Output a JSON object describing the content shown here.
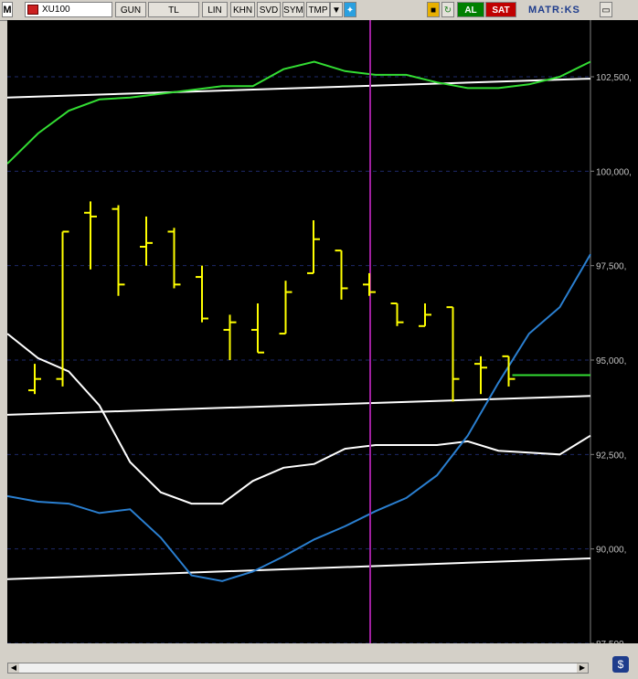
{
  "toolbar": {
    "m_label": "M",
    "symbol": "XU100",
    "buttons": [
      "GUN",
      "TL",
      "LIN",
      "KHN",
      "SVD",
      "SYM",
      "TMP"
    ],
    "buy_label": "AL",
    "sell_label": "SAT",
    "logo": "MATR:KS",
    "dropdown_icon": "chevron-down-icon",
    "twitter_icon": "twitter-icon",
    "lock_icon": "lock-icon",
    "refresh_icon": "refresh-icon",
    "minimize_icon": "minimize-icon"
  },
  "colors": {
    "background": "#000000",
    "bar_color": "#ffff00",
    "green_line": "#33dd33",
    "blue_line": "#2a7fd0",
    "white_line": "#ffffff",
    "cursor_line": "#a020a0",
    "buy_bg": "#008000",
    "sell_bg": "#c00000"
  },
  "chart_data": {
    "type": "ohlc",
    "ylim": [
      87500,
      104000
    ],
    "y_ticks": [
      "102,500,",
      "100,000,",
      "97,500,",
      "95,000,",
      "92,500,",
      "90,000,",
      "87,500,"
    ],
    "y_tick_values": [
      102500,
      100000,
      97500,
      95000,
      92500,
      90000,
      87500
    ],
    "bars": [
      {
        "o": 94200,
        "h": 94900,
        "l": 94100,
        "c": 94500
      },
      {
        "o": 94500,
        "h": 98400,
        "l": 94300,
        "c": 98400
      },
      {
        "o": 98900,
        "h": 99200,
        "l": 97400,
        "c": 98800
      },
      {
        "o": 99000,
        "h": 99100,
        "l": 96700,
        "c": 97000
      },
      {
        "o": 98000,
        "h": 98800,
        "l": 97500,
        "c": 98100
      },
      {
        "o": 98400,
        "h": 98500,
        "l": 96900,
        "c": 97000
      },
      {
        "o": 97200,
        "h": 97500,
        "l": 96000,
        "c": 96100
      },
      {
        "o": 95800,
        "h": 96200,
        "l": 95000,
        "c": 96000
      },
      {
        "o": 95800,
        "h": 96500,
        "l": 95200,
        "c": 95200
      },
      {
        "o": 95700,
        "h": 97100,
        "l": 95700,
        "c": 96800
      },
      {
        "o": 97300,
        "h": 98700,
        "l": 97300,
        "c": 98200
      },
      {
        "o": 97900,
        "h": 97900,
        "l": 96600,
        "c": 96900
      },
      {
        "o": 97000,
        "h": 97300,
        "l": 96700,
        "c": 96800
      },
      {
        "o": 96500,
        "h": 96500,
        "l": 95900,
        "c": 96000
      },
      {
        "o": 95900,
        "h": 96500,
        "l": 95900,
        "c": 96200
      },
      {
        "o": 96400,
        "h": 96400,
        "l": 93900,
        "c": 94500
      },
      {
        "o": 94900,
        "h": 95100,
        "l": 94100,
        "c": 94800
      },
      {
        "o": 95100,
        "h": 95100,
        "l": 94300,
        "c": 94500
      }
    ],
    "last_close": 94600,
    "green_line": [
      100200,
      101000,
      101600,
      101900,
      101950,
      102050,
      102150,
      102250,
      102250,
      102700,
      102900,
      102650,
      102550,
      102550,
      102350,
      102200,
      102200,
      102300,
      102500,
      102900
    ],
    "blue_line": [
      91400,
      91250,
      91200,
      90950,
      91050,
      90300,
      89300,
      89150,
      89400,
      89800,
      90250,
      90600,
      91000,
      91350,
      91950,
      93000,
      94400,
      95700,
      96400,
      97800
    ],
    "white_upper_line": [
      95700,
      95050,
      94700,
      93800,
      92300,
      91500,
      91200,
      91200,
      91800,
      92150,
      92250,
      92650,
      92750,
      92750,
      92750,
      92850,
      92600,
      92550,
      92500,
      93000
    ],
    "trend_top": [
      101950,
      102450
    ],
    "trend_mid": [
      93550,
      94050
    ],
    "trend_low": [
      89200,
      89750
    ]
  }
}
